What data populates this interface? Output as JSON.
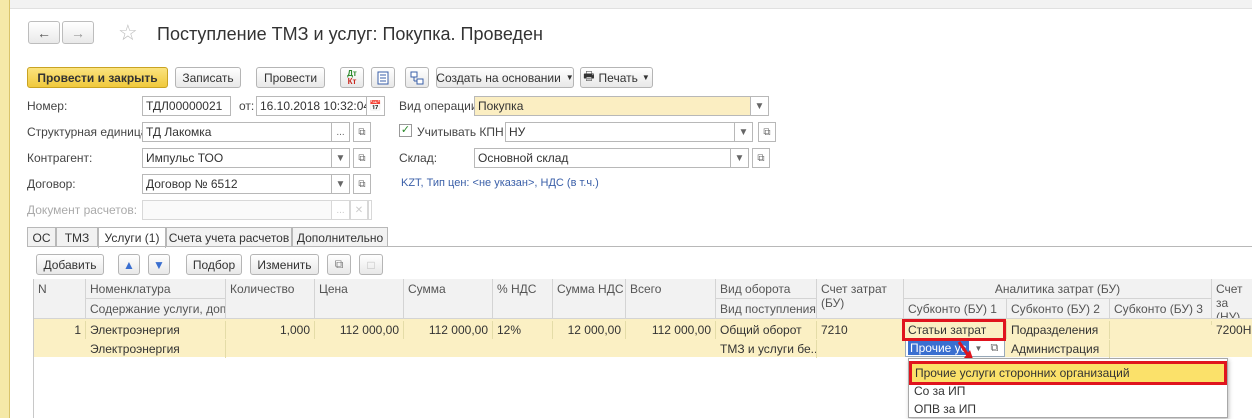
{
  "window": {
    "title": "Поступление ТМЗ и услуг: Покупка. Проведен"
  },
  "toolbar": {
    "post_close": "Провести и закрыть",
    "save": "Записать",
    "post": "Провести",
    "dt_kt": "Дт",
    "dt_kt2": "Кт",
    "create_based": "Создать на основании",
    "print": "Печать"
  },
  "form": {
    "number_label": "Номер:",
    "number_value": "ТДЛ00000021",
    "from_label": "от:",
    "date_value": "16.10.2018 10:32:04",
    "operation_label": "Вид операции:",
    "operation_value": "Покупка",
    "struct_label": "Структурная единица:",
    "struct_value": "ТД Лакомка",
    "kpn_label": "Учитывать КПН",
    "kpn_value": "НУ",
    "counterparty_label": "Контрагент:",
    "counterparty_value": "Импульс ТОО",
    "warehouse_label": "Склад:",
    "warehouse_value": "Основной склад",
    "contract_label": "Договор:",
    "contract_value": "Договор № 6512",
    "currency_link": "KZT, Тип цен: <не указан>, НДС (в т.ч.)",
    "settlement_doc_label": "Документ расчетов:"
  },
  "tabs": [
    {
      "label": "ОС"
    },
    {
      "label": "ТМЗ"
    },
    {
      "label": "Услуги (1)"
    },
    {
      "label": "Счета учета расчетов"
    },
    {
      "label": "Дополнительно"
    }
  ],
  "table_toolbar": {
    "add": "Добавить",
    "select": "Подбор",
    "change": "Изменить"
  },
  "table": {
    "headers": {
      "n": "N",
      "nomenclature": "Номенклатура",
      "content": "Содержание услуги, доп.",
      "qty": "Количество",
      "price": "Цена",
      "sum": "Сумма",
      "vat_pct": "% НДС",
      "vat_sum": "Сумма НДС",
      "total": "Всего",
      "turnover": "Вид оборота",
      "receipt_type": "Вид поступления",
      "cost_account": "Счет затрат (БУ)",
      "analytics": "Аналитика затрат (БУ)",
      "sub1": "Субконто (БУ) 1",
      "sub2": "Субконто (БУ) 2",
      "sub3": "Субконто (БУ) 3",
      "cost_account_nu": "Счет за (НУ)"
    },
    "row": {
      "n": "1",
      "nomenclature": "Электроэнергия",
      "content": "Электроэнергия",
      "qty": "1,000",
      "price": "112 000,00",
      "sum": "112 000,00",
      "vat_pct": "12%",
      "vat_sum": "12 000,00",
      "total": "112 000,00",
      "turnover": "Общий оборот",
      "receipt_type": "ТМЗ и услуги бе...",
      "cost_account": "7210",
      "sub1": "Статьи затрат",
      "sub1_value": "Прочие ус",
      "sub2": "Подразделения",
      "sub2_value": "Администрация",
      "cost_account_nu": "7200Н"
    }
  },
  "dropdown": {
    "items": [
      "Прочие услуги сторонних организаций",
      "Со за ИП",
      "ОПВ за ИП"
    ]
  },
  "colors": {
    "accent": "#f0c93c",
    "highlight_border": "#e0141e",
    "row_bg": "#fbf0c4",
    "link": "#3a5fa8"
  }
}
